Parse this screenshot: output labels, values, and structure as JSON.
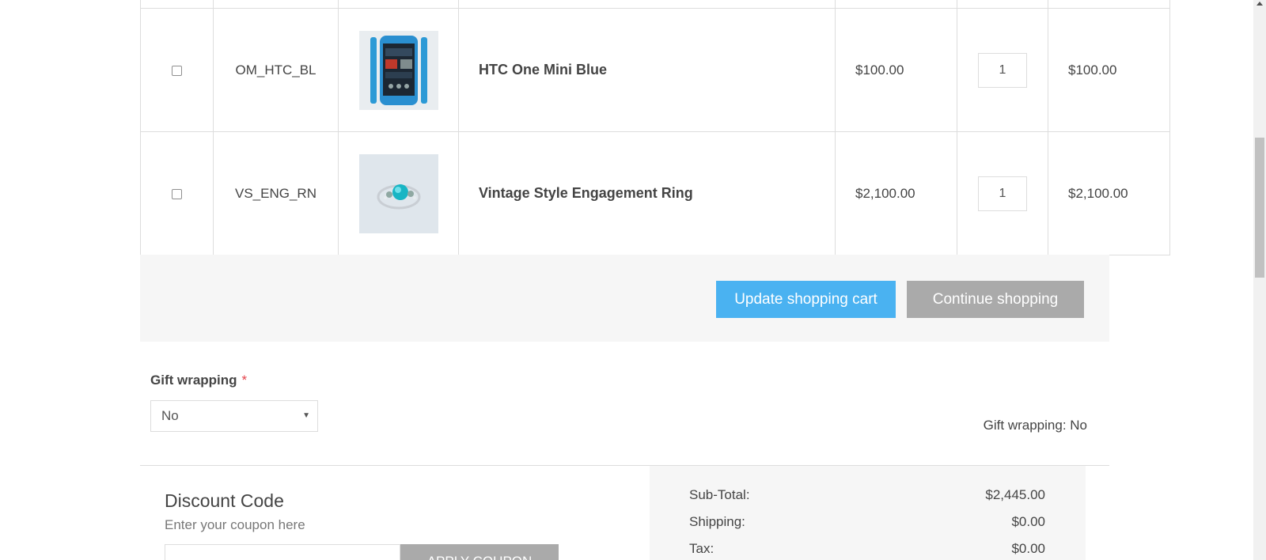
{
  "cart": {
    "items": [
      {
        "sku": "OM_HTC_BL",
        "name": "HTC One Mini Blue",
        "image": "phone-image",
        "price": "$100.00",
        "quantity": "1",
        "total": "$100.00"
      },
      {
        "sku": "VS_ENG_RN",
        "name": "Vintage Style Engagement Ring",
        "image": "ring-image",
        "price": "$2,100.00",
        "quantity": "1",
        "total": "$2,100.00"
      }
    ],
    "update_label": "Update shopping cart",
    "continue_label": "Continue shopping"
  },
  "gift_wrapping": {
    "label": "Gift wrapping",
    "required_mark": "*",
    "selected": "No",
    "summary": "Gift wrapping: No"
  },
  "discount": {
    "title": "Discount Code",
    "subtitle": "Enter your coupon here",
    "apply_label": "APPLY COUPON"
  },
  "totals": {
    "subtotal_label": "Sub-Total:",
    "subtotal_value": "$2,445.00",
    "shipping_label": "Shipping:",
    "shipping_value": "$0.00",
    "tax_label": "Tax:",
    "tax_value": "$0.00"
  },
  "colors": {
    "update_button": "#4ab2f1",
    "continue_button": "#aaaaaa",
    "required_mark": "#e4434b"
  }
}
